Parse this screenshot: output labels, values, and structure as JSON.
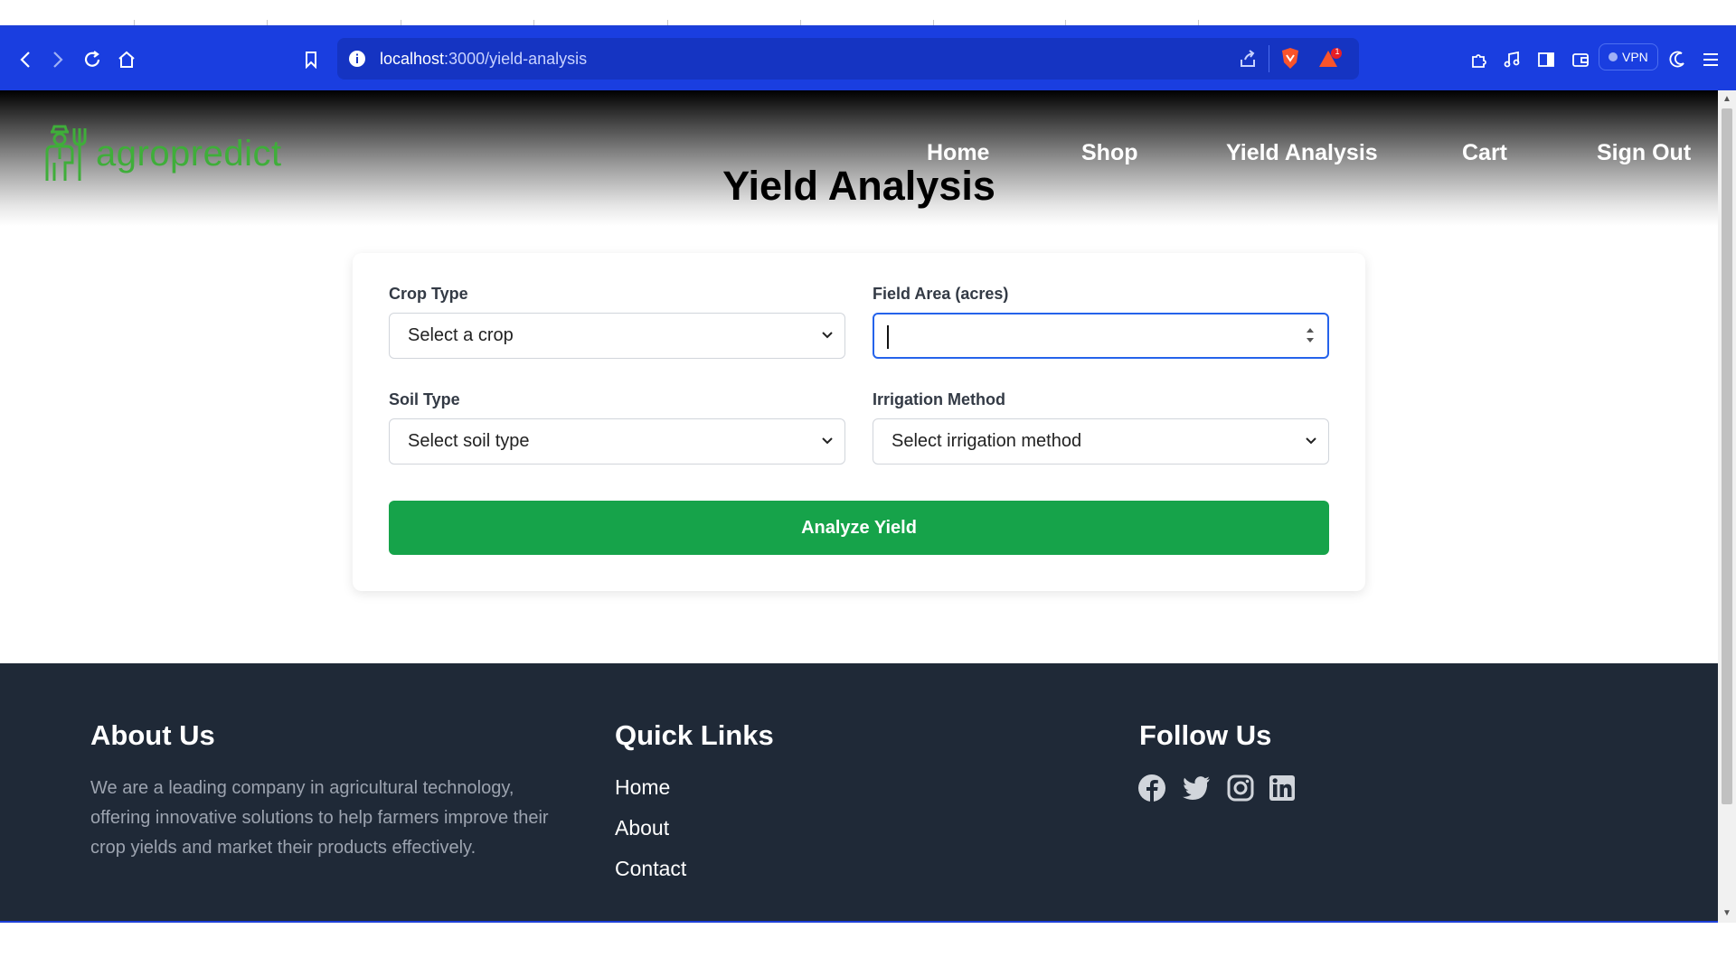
{
  "browser": {
    "url_host": "localhost",
    "url_path": ":3000/yield-analysis",
    "vpn_label": "VPN",
    "notification_count": "1"
  },
  "header": {
    "logo_text": "agropredict",
    "nav": [
      "Home",
      "Shop",
      "Yield Analysis",
      "Cart",
      "Sign Out"
    ],
    "page_title": "Yield Analysis"
  },
  "form": {
    "crop_type_label": "Crop Type",
    "crop_type_value": "Select a crop",
    "field_area_label": "Field Area (acres)",
    "field_area_value": "",
    "soil_type_label": "Soil Type",
    "soil_type_value": "Select soil type",
    "irrigation_label": "Irrigation Method",
    "irrigation_value": "Select irrigation method",
    "submit_label": "Analyze Yield"
  },
  "footer": {
    "about_heading": "About Us",
    "about_text": "We are a leading company in agricultural technology, offering innovative solutions to help farmers improve their crop yields and market their products effectively.",
    "links_heading": "Quick Links",
    "links": [
      "Home",
      "About",
      "Contact"
    ],
    "follow_heading": "Follow Us",
    "social": [
      "facebook-icon",
      "twitter-icon",
      "instagram-icon",
      "linkedin-icon"
    ]
  },
  "colors": {
    "brand_green": "#3fae3a",
    "button_green": "#16a34a",
    "footer_bg": "#1f2937",
    "toolbar_blue": "#1a3ee0",
    "focus_blue": "#2563eb"
  }
}
